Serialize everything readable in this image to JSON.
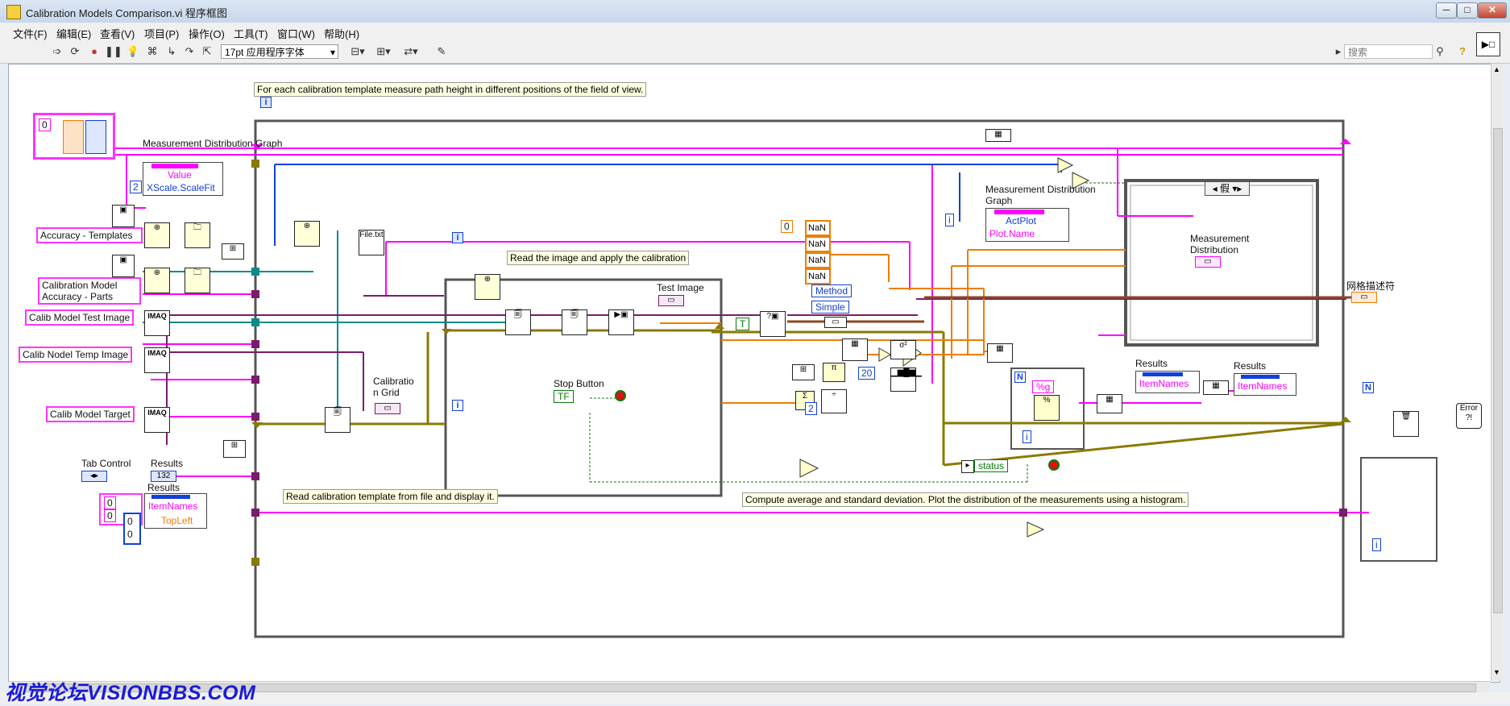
{
  "window": {
    "title": "Calibration Models Comparison.vi 程序框图",
    "min": "─",
    "max": "□",
    "close": "✕"
  },
  "menu": [
    "文件(F)",
    "编辑(E)",
    "查看(V)",
    "项目(P)",
    "操作(O)",
    "工具(T)",
    "窗口(W)",
    "帮助(H)"
  ],
  "toolbar": {
    "font": "17pt 应用程序字体",
    "search_placeholder": "搜索",
    "help": "?"
  },
  "comments": {
    "top": "For each calibration template measure path height in different positions of the field of view.",
    "read_apply": "Read the image and apply the calibration",
    "read_template": "Read calibration template from file and display it.",
    "compute": "Compute average and standard deviation. Plot the distribution of the measurements using a histogram."
  },
  "controls": {
    "index_const": "0",
    "accuracy_templates": "Accuracy - Templates",
    "calibration_model_accuracy": "Calibration Model Accuracy - Parts",
    "calib_model_test_image": "Calib Model Test Image",
    "calib_nodel_temp_image": "Calib Nodel Temp Image",
    "calib_model_target": "Calib Model Target",
    "tab_control": "Tab Control",
    "results_label": "Results",
    "results_label2": "Results",
    "results_label3": "Results",
    "results_label4": "Results",
    "imaq": "IMAQ"
  },
  "nodes": {
    "mdg_label": "Measurement Distribution Graph",
    "value": "Value",
    "xscale": "XScale.ScaleFit",
    "const_2": "2",
    "calibration_grid": "Calibratio n Grid",
    "test_image": "Test Image",
    "stop_button": "Stop Button",
    "tf": "TF",
    "t_const": "T",
    "mdg_label2": "Measurement Distribution Graph",
    "actplot": "ActPlot",
    "plot_name": "Plot.Name",
    "i_const": "i",
    "method": "Method",
    "simple": "Simple",
    "nan": "NaN",
    "zero": "0",
    "const_20": "20",
    "const_2b": "2",
    "fmt": "%g",
    "status": "status",
    "case_label": "假",
    "md_label": "Measurement Distribution",
    "item_names": "ItemNames",
    "item_names2": "ItemNames",
    "item_names3": "ItemNames",
    "topleft": "TopLeft",
    "table_desc": "网格描述符",
    "file_txt": "File.txt",
    "zero_a": "0",
    "zero_b": "0",
    "error": "Error ?!"
  },
  "watermark": "视觉论坛VISIONBBS.COM",
  "colors": {
    "pink": "#ff00ff",
    "blue": "#1240d8",
    "orange": "#f07c00",
    "green": "#0b7a0b",
    "teal": "#0a8a8a",
    "olive": "#8a7a00",
    "purple": "#7a1b6b"
  }
}
